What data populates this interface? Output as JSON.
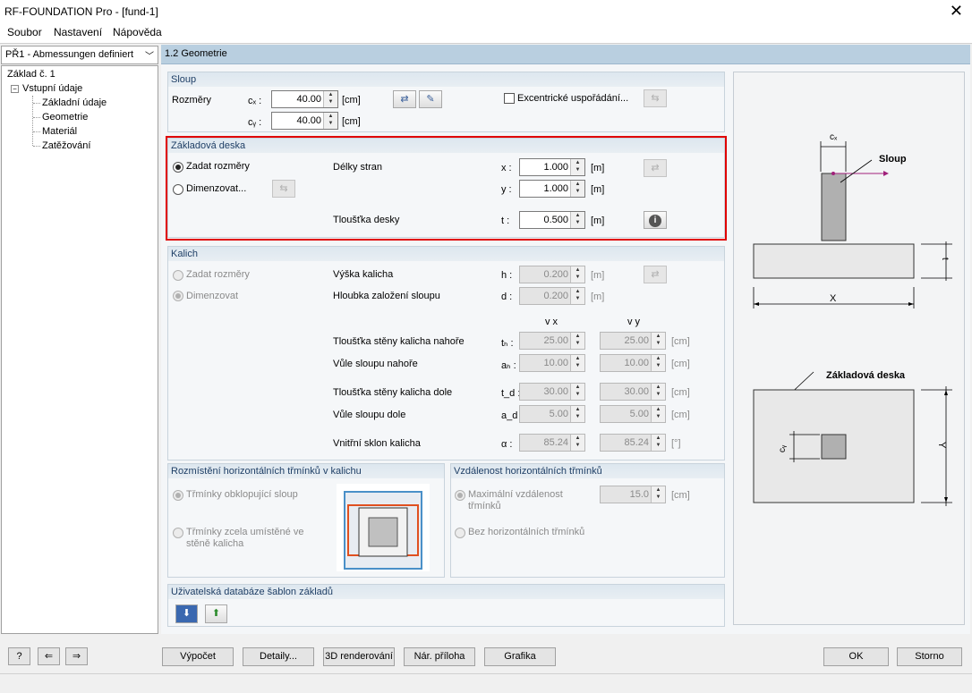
{
  "window": {
    "title": "RF-FOUNDATION Pro - [fund-1]",
    "close": "✕"
  },
  "menu": [
    "Soubor",
    "Nastavení",
    "Nápověda"
  ],
  "nav": {
    "selected": "PŘ1 - Abmessungen definiert",
    "tree_root": "Základ č. 1",
    "tree_group": "Vstupní údaje",
    "tree_items": [
      "Základní údaje",
      "Geometrie",
      "Materiál",
      "Zatěžování"
    ]
  },
  "section_header": "1.2 Geometrie",
  "sloup": {
    "title": "Sloup",
    "rozmery": "Rozměry",
    "cx_label": "cₓ :",
    "cy_label": "cᵧ :",
    "cx": "40.00",
    "cy": "40.00",
    "unit": "[cm]",
    "excentric": "Excentrické uspořádání..."
  },
  "deska": {
    "title": "Základová deska",
    "opt1": "Zadat rozměry",
    "opt2": "Dimenzovat...",
    "delky": "Délky stran",
    "x_label": "x :",
    "y_label": "y :",
    "x": "1.000",
    "y": "1.000",
    "tloustka": "Tloušťka desky",
    "t_label": "t :",
    "t": "0.500",
    "unit": "[m]"
  },
  "kalich": {
    "title": "Kalich",
    "opt1": "Zadat rozměry",
    "opt2": "Dimenzovat",
    "vyska": "Výška kalicha",
    "h_label": "h :",
    "h": "0.200",
    "hloubka": "Hloubka založení sloupu",
    "d_label": "d :",
    "d": "0.200",
    "unit_m": "[m]",
    "col_x": "v x",
    "col_y": "v y",
    "rows": [
      {
        "label": "Tloušťka stěny kalicha nahoře",
        "sym": "tₕ :",
        "x": "25.00",
        "y": "25.00",
        "unit": "[cm]"
      },
      {
        "label": "Vůle sloupu nahoře",
        "sym": "aₕ :",
        "x": "10.00",
        "y": "10.00",
        "unit": "[cm]"
      },
      {
        "label": "Tloušťka stěny kalicha dole",
        "sym": "t_d :",
        "x": "30.00",
        "y": "30.00",
        "unit": "[cm]"
      },
      {
        "label": "Vůle sloupu dole",
        "sym": "a_d :",
        "x": "5.00",
        "y": "5.00",
        "unit": "[cm]"
      },
      {
        "label": "Vnitřní sklon kalicha",
        "sym": "α :",
        "x": "85.24",
        "y": "85.24",
        "unit": "[°]"
      }
    ]
  },
  "rozmisteni": {
    "title": "Rozmístění horizontálních třmínků v kalichu",
    "opt1": "Třmínky obklopující sloup",
    "opt2": "Třmínky zcela umístěné ve stěně kalicha"
  },
  "vzdalenost": {
    "title": "Vzdálenost horizontálních třmínků",
    "opt1": "Maximální vzdálenost třmínků",
    "val": "15.0",
    "unit": "[cm]",
    "opt2": "Bez horizontálních třmínků"
  },
  "databaze": {
    "title": "Uživatelská databáze šablon základů"
  },
  "preview": {
    "cx": "cₓ",
    "sloup": "Sloup",
    "t": "t",
    "x": "X",
    "deska": "Základová deska",
    "cy": "cᵧ",
    "y": "Y"
  },
  "buttons": {
    "vypocet": "Výpočet",
    "detaily": "Detaily...",
    "render": "3D renderování",
    "priloha": "Nár. příloha",
    "grafika": "Grafika",
    "ok": "OK",
    "storno": "Storno"
  }
}
